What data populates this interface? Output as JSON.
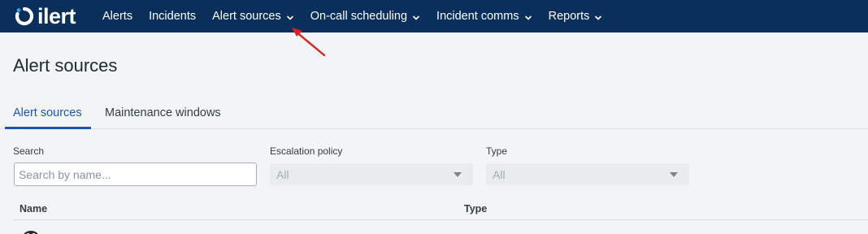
{
  "brand": {
    "name": "ilert",
    "colors": {
      "nav_bg": "#0b2f5b",
      "accent": "#1a56b8",
      "annotation_arrow": "#e02020"
    }
  },
  "nav": {
    "items": [
      {
        "label": "Alerts",
        "has_dropdown": false
      },
      {
        "label": "Incidents",
        "has_dropdown": false
      },
      {
        "label": "Alert sources",
        "has_dropdown": true
      },
      {
        "label": "On-call scheduling",
        "has_dropdown": true
      },
      {
        "label": "Incident comms",
        "has_dropdown": true
      },
      {
        "label": "Reports",
        "has_dropdown": true
      }
    ]
  },
  "page": {
    "title": "Alert sources"
  },
  "tabs": [
    {
      "label": "Alert sources",
      "active": true
    },
    {
      "label": "Maintenance windows",
      "active": false
    }
  ],
  "filters": {
    "search": {
      "label": "Search",
      "placeholder": "Search by name...",
      "value": ""
    },
    "escalation_policy": {
      "label": "Escalation policy",
      "value": "All"
    },
    "type": {
      "label": "Type",
      "value": "All"
    }
  },
  "table": {
    "columns": [
      "Name",
      "Type"
    ]
  },
  "icons": {
    "logo": "ilert-logo-icon",
    "chevron": "chevron-down-icon",
    "caret": "caret-down-icon",
    "annotation": "red-arrow-annotation",
    "row": "source-avatar-icon"
  }
}
